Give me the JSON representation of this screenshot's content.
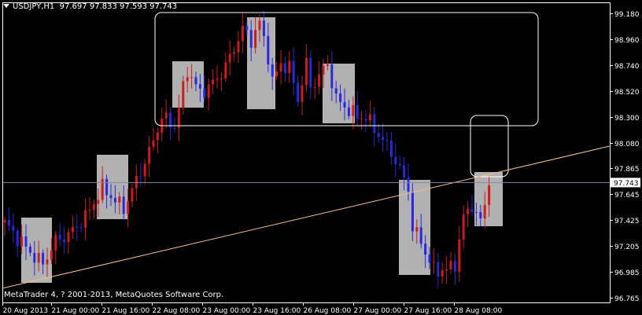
{
  "header": {
    "symbol_timeframe": "USDJPY,H1",
    "ohlc": "97.697 97.833 97.593 97.743"
  },
  "copyright": "MetaTrader 4, ? 2001-2013, MetaQuotes Software Corp.",
  "current_price_label": "97.743",
  "colors": {
    "background": "#000000",
    "bull": "#d11a1a",
    "bear": "#2828e0",
    "axis": "#ffffff",
    "trendline": "#f5c08a",
    "box_fill": "#c0c0c0",
    "price_line": "#8a8aa0"
  },
  "chart_data": {
    "type": "candlestick",
    "symbol": "USDJPY",
    "timeframe": "H1",
    "y_ticks": [
      99.18,
      98.96,
      98.74,
      98.52,
      98.3,
      98.08,
      97.865,
      97.645,
      97.425,
      97.205,
      96.985,
      96.765
    ],
    "y_tick_labels": [
      "99.180",
      "98.960",
      "98.740",
      "98.520",
      "98.300",
      "98.080",
      "97.865",
      "97.645",
      "97.425",
      "97.205",
      "96.985",
      "96.765"
    ],
    "ylim": [
      96.765,
      99.18
    ],
    "x_tick_labels": [
      "20 Aug 2013",
      "21 Aug 00:00",
      "21 Aug 16:00",
      "22 Aug 08:00",
      "23 Aug 00:00",
      "23 Aug 16:00",
      "26 Aug 08:00",
      "27 Aug 00:00",
      "27 Aug 16:00",
      "28 Aug 08:00"
    ],
    "last_price": 97.743,
    "path_points": [
      [
        0,
        97.4
      ],
      [
        6,
        97.15
      ],
      [
        9,
        97.05
      ],
      [
        12,
        97.25
      ],
      [
        15,
        97.3
      ],
      [
        19,
        97.45
      ],
      [
        23,
        97.7
      ],
      [
        28,
        97.52
      ],
      [
        34,
        98.0
      ],
      [
        37,
        98.3
      ],
      [
        40,
        98.22
      ],
      [
        43,
        98.7
      ],
      [
        46,
        98.5
      ],
      [
        50,
        98.62
      ],
      [
        53,
        98.8
      ],
      [
        56,
        99.05
      ],
      [
        58,
        98.95
      ],
      [
        60,
        99.1
      ],
      [
        62,
        98.82
      ],
      [
        63,
        98.6
      ],
      [
        65,
        98.75
      ],
      [
        67,
        98.72
      ],
      [
        69,
        98.45
      ],
      [
        71,
        98.75
      ],
      [
        72,
        98.55
      ],
      [
        76,
        98.75
      ],
      [
        78,
        98.45
      ],
      [
        83,
        98.3
      ],
      [
        85,
        98.3
      ],
      [
        87,
        98.2
      ],
      [
        91,
        98.0
      ],
      [
        95,
        97.7
      ],
      [
        96,
        97.35
      ],
      [
        98,
        97.25
      ],
      [
        99,
        97.15
      ],
      [
        101,
        97.0
      ],
      [
        104,
        97.0
      ],
      [
        106,
        97.05
      ],
      [
        107,
        97.25
      ],
      [
        108,
        97.45
      ],
      [
        110,
        97.55
      ],
      [
        112,
        97.4
      ],
      [
        114,
        97.75
      ]
    ]
  }
}
